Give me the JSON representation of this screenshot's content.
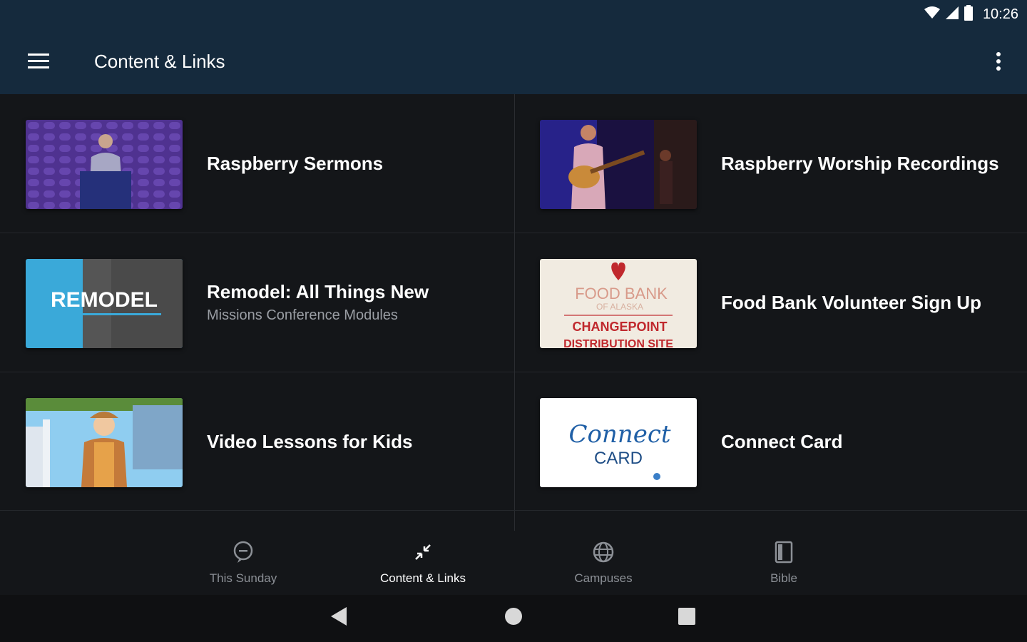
{
  "status_bar": {
    "time": "10:26",
    "icons": [
      "wifi-icon",
      "signal-icon",
      "battery-icon"
    ]
  },
  "app_bar": {
    "title": "Content & Links",
    "menu_icon": "hamburger-menu-icon",
    "overflow_icon": "more-vertical-icon"
  },
  "items": [
    {
      "title": "Raspberry Sermons",
      "subtitle": "",
      "thumbnail": "sermon-thumbnail"
    },
    {
      "title": "Raspberry Worship Recordings",
      "subtitle": "",
      "thumbnail": "worship-thumbnail"
    },
    {
      "title": "Remodel: All Things New",
      "subtitle": "Missions Conference Modules",
      "thumbnail": "remodel-thumbnail",
      "thumb_text": "REMODEL"
    },
    {
      "title": "Food Bank Volunteer Sign Up",
      "subtitle": "",
      "thumbnail": "food-bank-thumbnail",
      "thumb_text": [
        "FOOD BANK",
        "OF ALASKA",
        "CHANGEPOINT",
        "DISTRIBUTION SITE"
      ]
    },
    {
      "title": "Video Lessons for Kids",
      "subtitle": "",
      "thumbnail": "kids-lessons-thumbnail"
    },
    {
      "title": "Connect Card",
      "subtitle": "",
      "thumbnail": "connect-card-thumbnail",
      "thumb_text": [
        "Connect",
        "CARD"
      ]
    }
  ],
  "bottom_nav": [
    {
      "label": "This Sunday",
      "icon": "chat-bubble-icon",
      "active": false
    },
    {
      "label": "Content & Links",
      "icon": "arrows-collapse-icon",
      "active": true
    },
    {
      "label": "Campuses",
      "icon": "globe-icon",
      "active": false
    },
    {
      "label": "Bible",
      "icon": "book-icon",
      "active": false
    }
  ],
  "system_nav": [
    "back-icon",
    "home-icon",
    "recents-icon"
  ],
  "colors": {
    "app_bar": "#152a3d",
    "background": "#141619",
    "text_primary": "#ffffff",
    "text_secondary": "#9a9ea4",
    "food_bank_red": "#c0282d",
    "connect_blue": "#1f5fa6"
  }
}
